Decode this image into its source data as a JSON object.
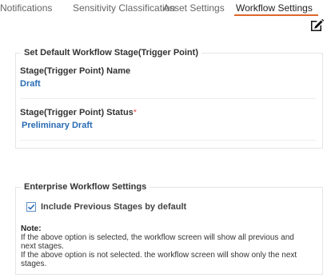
{
  "tabs": [
    {
      "label": "Notifications",
      "active": false
    },
    {
      "label": "Sensitivity Classification",
      "active": false
    },
    {
      "label": "Asset Settings",
      "active": false
    },
    {
      "label": "Workflow Settings",
      "active": true
    }
  ],
  "toolbar": {
    "edit_icon": "pencil-edit-icon"
  },
  "default_stage": {
    "legend": "Set Default Workflow Stage(Trigger Point)",
    "name_label": "Stage(Trigger Point) Name",
    "name_value": "Draft",
    "status_label": "Stage(Trigger Point) Status",
    "status_required_marker": "*",
    "status_value": "Preliminary Draft"
  },
  "enterprise": {
    "legend": "Enterprise Workflow Settings",
    "include_previous_label": "Include Previous Stages by default",
    "include_previous_checked": true,
    "note_title": "Note:",
    "note_lines": [
      "If the above option is selected, the workflow screen will show all previous and next stages.",
      "If the above option is not selected. the workflow screen will show only the next stages."
    ]
  },
  "colors": {
    "accent": "#e0662a",
    "link": "#2a6cb3",
    "required": "#d9534f",
    "checkbox": "#5b8fc7"
  }
}
